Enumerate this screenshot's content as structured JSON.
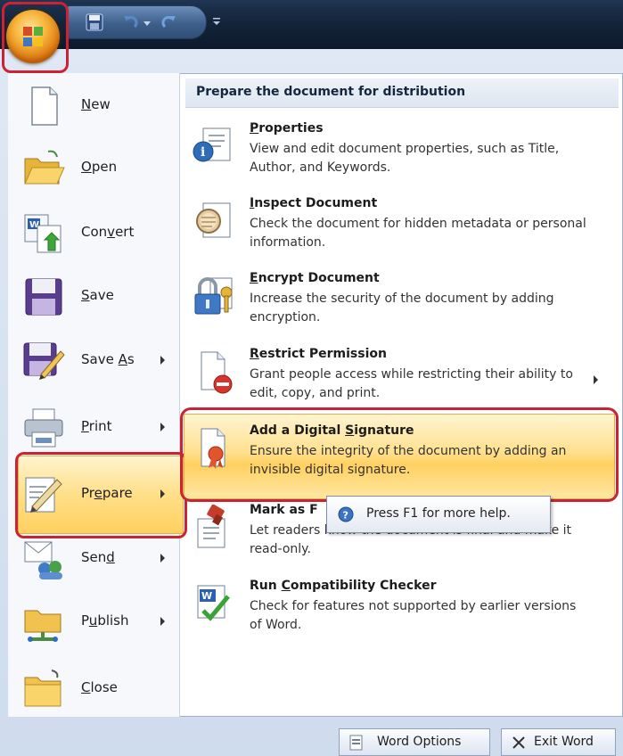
{
  "qat": {
    "save_icon": "save-icon",
    "undo_icon": "undo-icon",
    "redo_icon": "redo-icon"
  },
  "office_button": {
    "icon": "office-logo-icon"
  },
  "left_menu": {
    "items": [
      {
        "label": "New",
        "key": "N",
        "submenu": false,
        "icon": "new-document-icon"
      },
      {
        "label": "Open",
        "key": "O",
        "submenu": false,
        "icon": "open-folder-icon"
      },
      {
        "label": "Convert",
        "key": "v",
        "submenu": false,
        "icon": "convert-icon"
      },
      {
        "label": "Save",
        "key": "S",
        "submenu": false,
        "icon": "save-disk-icon"
      },
      {
        "label": "Save As",
        "key": "A",
        "submenu": true,
        "icon": "save-as-icon"
      },
      {
        "label": "Print",
        "key": "P",
        "submenu": true,
        "icon": "printer-icon"
      },
      {
        "label": "Prepare",
        "key": "e",
        "submenu": true,
        "icon": "prepare-icon",
        "selected": true
      },
      {
        "label": "Send",
        "key": "d",
        "submenu": true,
        "icon": "send-icon"
      },
      {
        "label": "Publish",
        "key": "u",
        "submenu": true,
        "icon": "publish-icon"
      },
      {
        "label": "Close",
        "key": "C",
        "submenu": false,
        "icon": "close-folder-icon"
      }
    ]
  },
  "prepare_panel": {
    "header": "Prepare the document for distribution",
    "items": [
      {
        "title": "Properties",
        "description": "View and edit document properties, such as Title, Author, and Keywords.",
        "icon": "properties-icon"
      },
      {
        "title": "Inspect Document",
        "description": "Check the document for hidden metadata or personal information.",
        "icon": "inspect-document-icon"
      },
      {
        "title": "Encrypt Document",
        "description": "Increase the security of the document by adding encryption.",
        "icon": "encrypt-lock-icon"
      },
      {
        "title": "Restrict Permission",
        "description": "Grant people access while restricting their ability to edit, copy, and print.",
        "icon": "restrict-permission-icon",
        "submenu": true
      },
      {
        "title": "Add a Digital Signature",
        "description": "Ensure the integrity of the document by adding an invisible digital signature.",
        "icon": "digital-signature-icon",
        "highlighted": true
      },
      {
        "title": "Mark as Final",
        "title_visible": "Mark as F",
        "description_visible": "Let readers know the document is final and make it read-only.",
        "icon": "mark-final-icon"
      },
      {
        "title": "Run Compatibility Checker",
        "description": "Check for features not supported by earlier versions of Word.",
        "icon": "compatibility-checker-icon"
      }
    ]
  },
  "tooltip": {
    "text": "Press F1 for more help.",
    "icon": "help-icon"
  },
  "bottom_buttons": {
    "word_options": "Word Options",
    "exit_word": "Exit Word"
  },
  "colors": {
    "highlight_outline": "#cc2233",
    "selected_fill": "#ffd060",
    "titlebar": "#14243a"
  }
}
